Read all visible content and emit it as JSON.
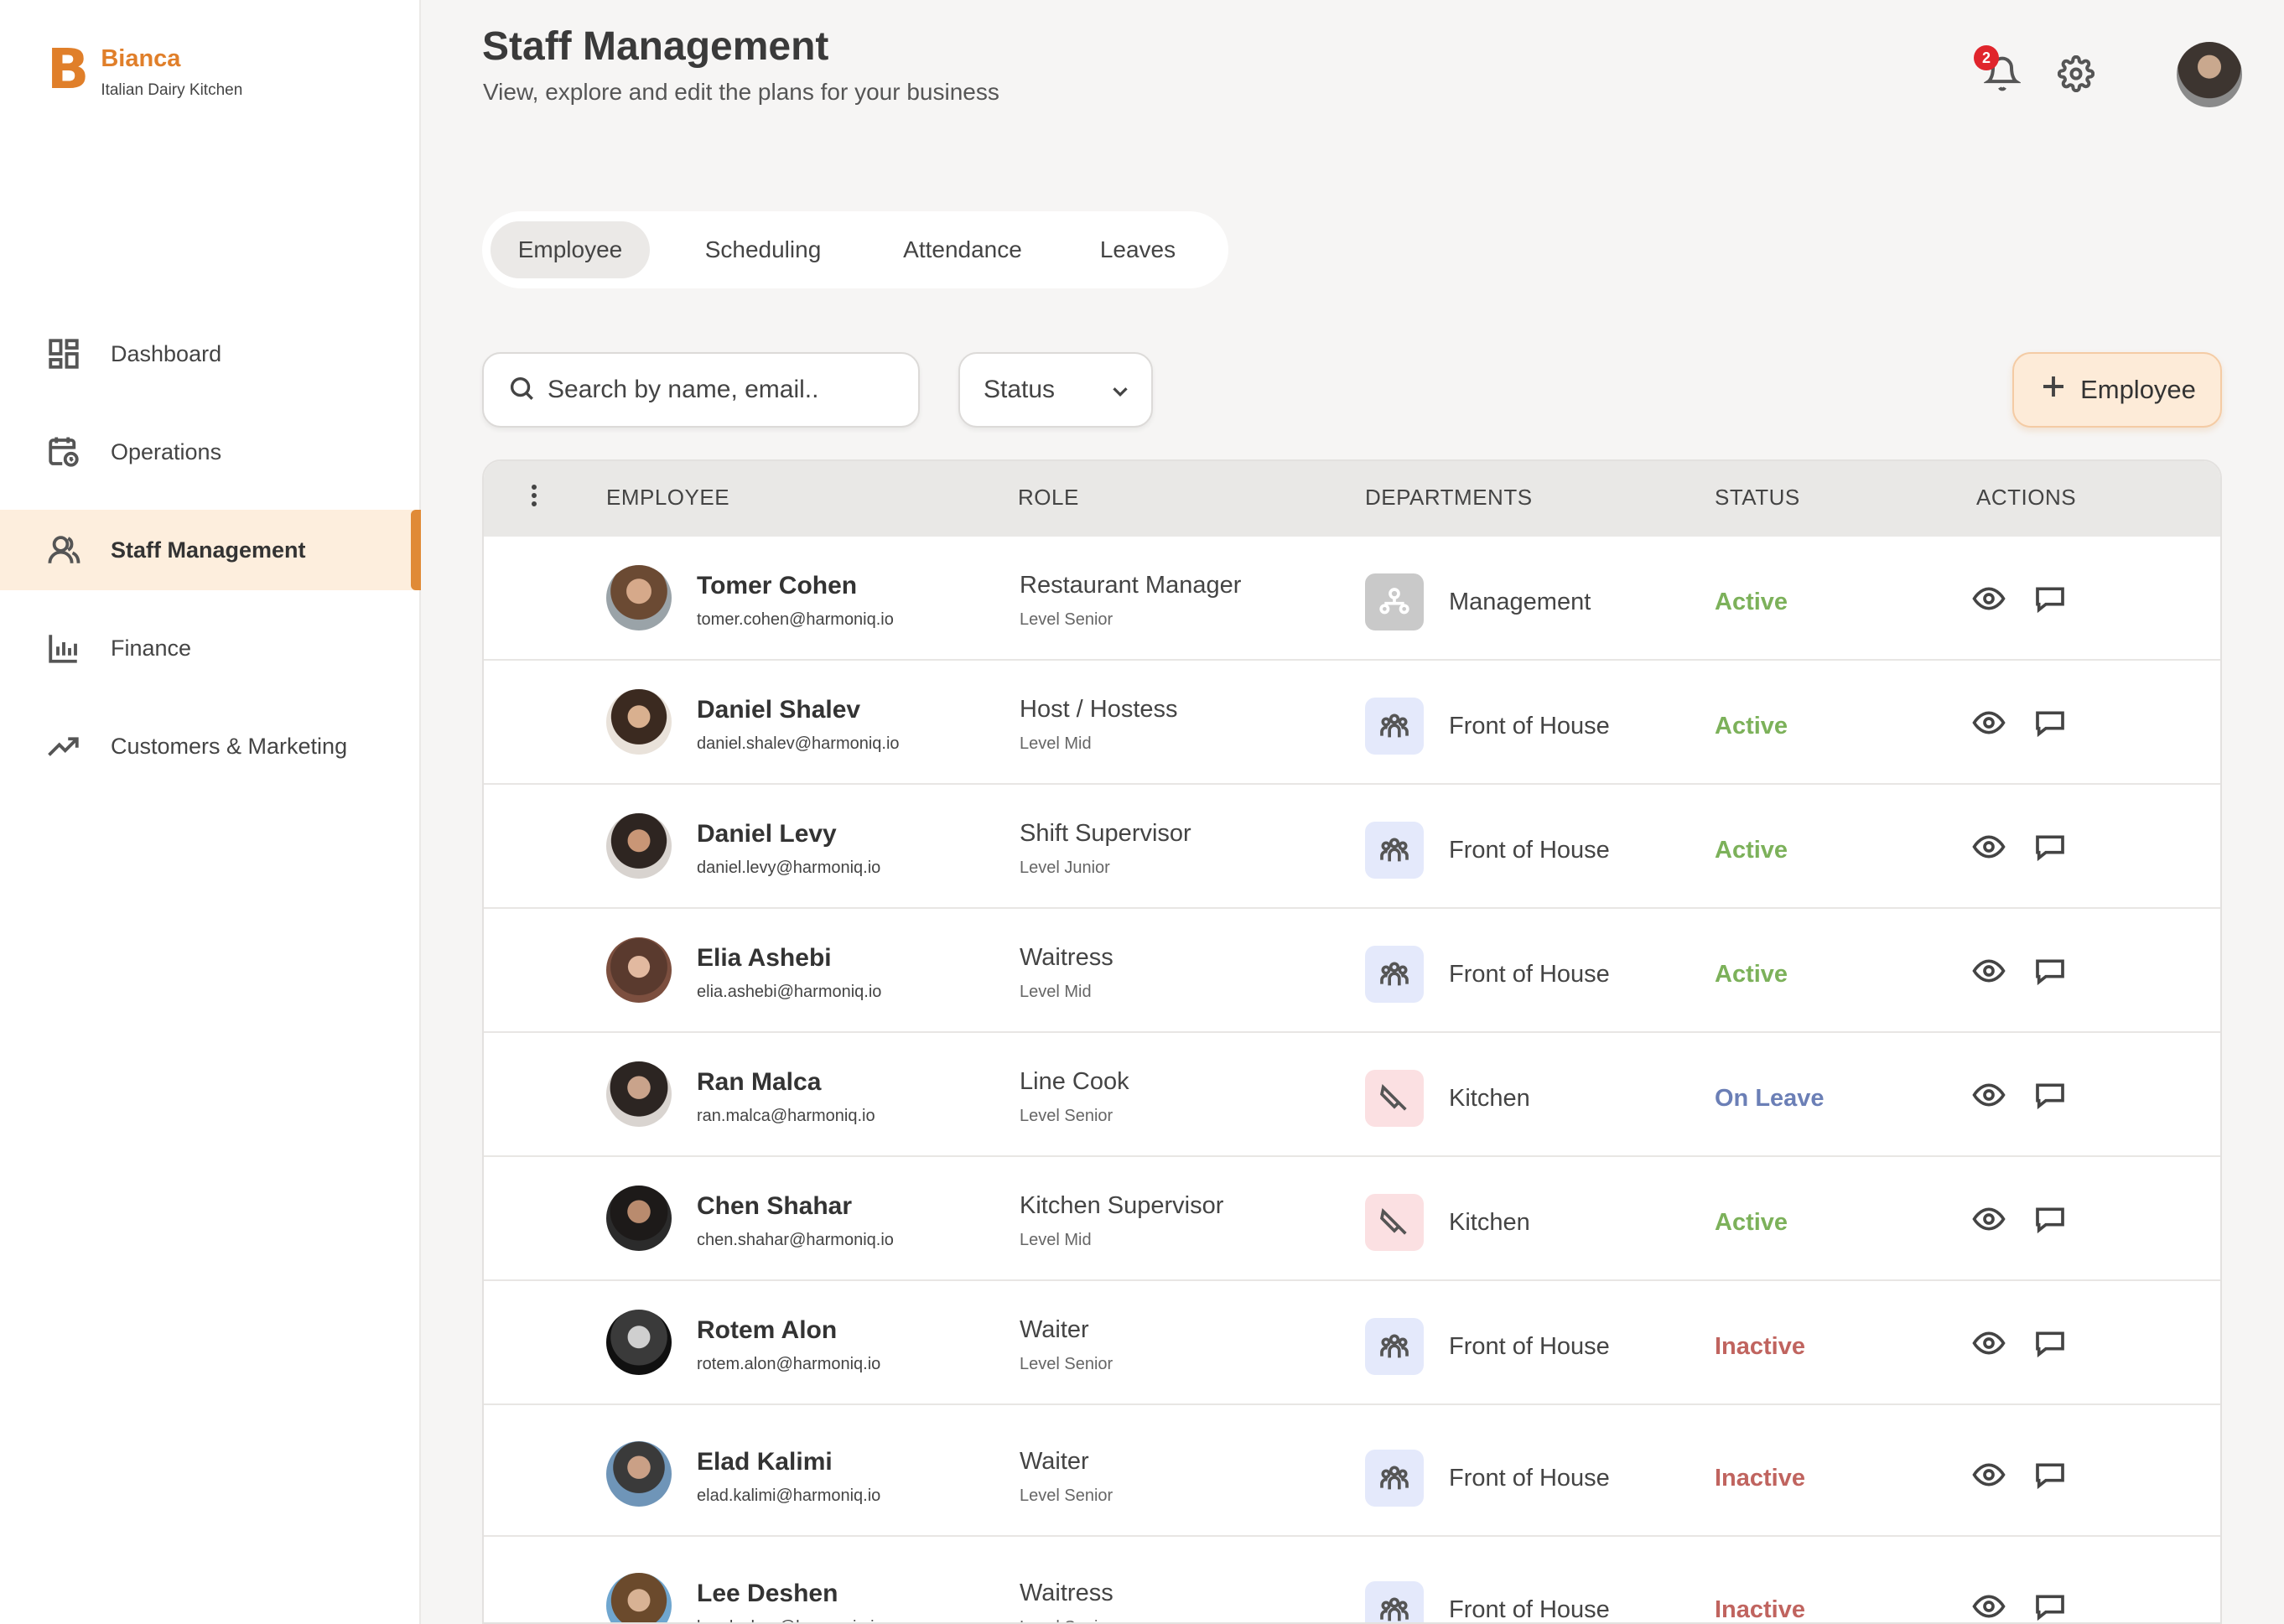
{
  "brand": {
    "logo": "B",
    "name": "Bianca",
    "subtitle": "Italian Dairy Kitchen"
  },
  "nav": [
    {
      "label": "Dashboard",
      "icon": "dashboard-icon"
    },
    {
      "label": "Operations",
      "icon": "calendar-clock-icon"
    },
    {
      "label": "Staff Management",
      "icon": "users-icon",
      "active": true
    },
    {
      "label": "Finance",
      "icon": "bar-chart-icon"
    },
    {
      "label": "Customers & Marketing",
      "icon": "trend-up-icon"
    }
  ],
  "header": {
    "title": "Staff Management",
    "subtitle": "View, explore and edit the plans for your business",
    "notifications": "2"
  },
  "tabs": [
    {
      "label": "Employee",
      "active": true
    },
    {
      "label": "Scheduling"
    },
    {
      "label": "Attendance"
    },
    {
      "label": "Leaves"
    }
  ],
  "search": {
    "placeholder": "Search by name, email.."
  },
  "status_filter": {
    "label": "Status"
  },
  "add_button": {
    "label": "Employee"
  },
  "table": {
    "headers": {
      "employee": "EMPLOYEE",
      "role": "ROLE",
      "departments": "DEPARTMENTS",
      "status": "STATUS",
      "actions": "ACTIONS"
    },
    "rows": [
      {
        "name": "Tomer Cohen",
        "email": "tomer.cohen@harmoniq.io",
        "role": "Restaurant Manager",
        "level": "Level Senior",
        "department": "Management",
        "status": "Active"
      },
      {
        "name": "Daniel Shalev",
        "email": "daniel.shalev@harmoniq.io",
        "role": "Host / Hostess",
        "level": "Level Mid",
        "department": "Front of House",
        "status": "Active"
      },
      {
        "name": "Daniel Levy",
        "email": "daniel.levy@harmoniq.io",
        "role": "Shift Supervisor",
        "level": "Level Junior",
        "department": "Front of House",
        "status": "Active"
      },
      {
        "name": "Elia Ashebi",
        "email": "elia.ashebi@harmoniq.io",
        "role": "Waitress",
        "level": "Level Mid",
        "department": "Front of House",
        "status": "Active"
      },
      {
        "name": "Ran Malca",
        "email": "ran.malca@harmoniq.io",
        "role": "Line Cook",
        "level": "Level Senior",
        "department": "Kitchen",
        "status": "On Leave"
      },
      {
        "name": "Chen Shahar",
        "email": "chen.shahar@harmoniq.io",
        "role": "Kitchen Supervisor",
        "level": "Level Mid",
        "department": "Kitchen",
        "status": "Active"
      },
      {
        "name": "Rotem Alon",
        "email": "rotem.alon@harmoniq.io",
        "role": "Waiter",
        "level": "Level Senior",
        "department": "Front of House",
        "status": "Inactive"
      },
      {
        "name": "Elad Kalimi",
        "email": "elad.kalimi@harmoniq.io",
        "role": "Waiter",
        "level": "Level Senior",
        "department": "Front of House",
        "status": "Inactive"
      },
      {
        "name": "Lee Deshen",
        "email": "lee.deshen@harmoniq.io",
        "role": "Waitress",
        "level": "Level Senior",
        "department": "Front of House",
        "status": "Inactive"
      }
    ]
  },
  "colors": {
    "accent": "#e07f2a",
    "active": "#7cb15a",
    "on_leave": "#6b7fb6",
    "inactive": "#c0645f"
  }
}
